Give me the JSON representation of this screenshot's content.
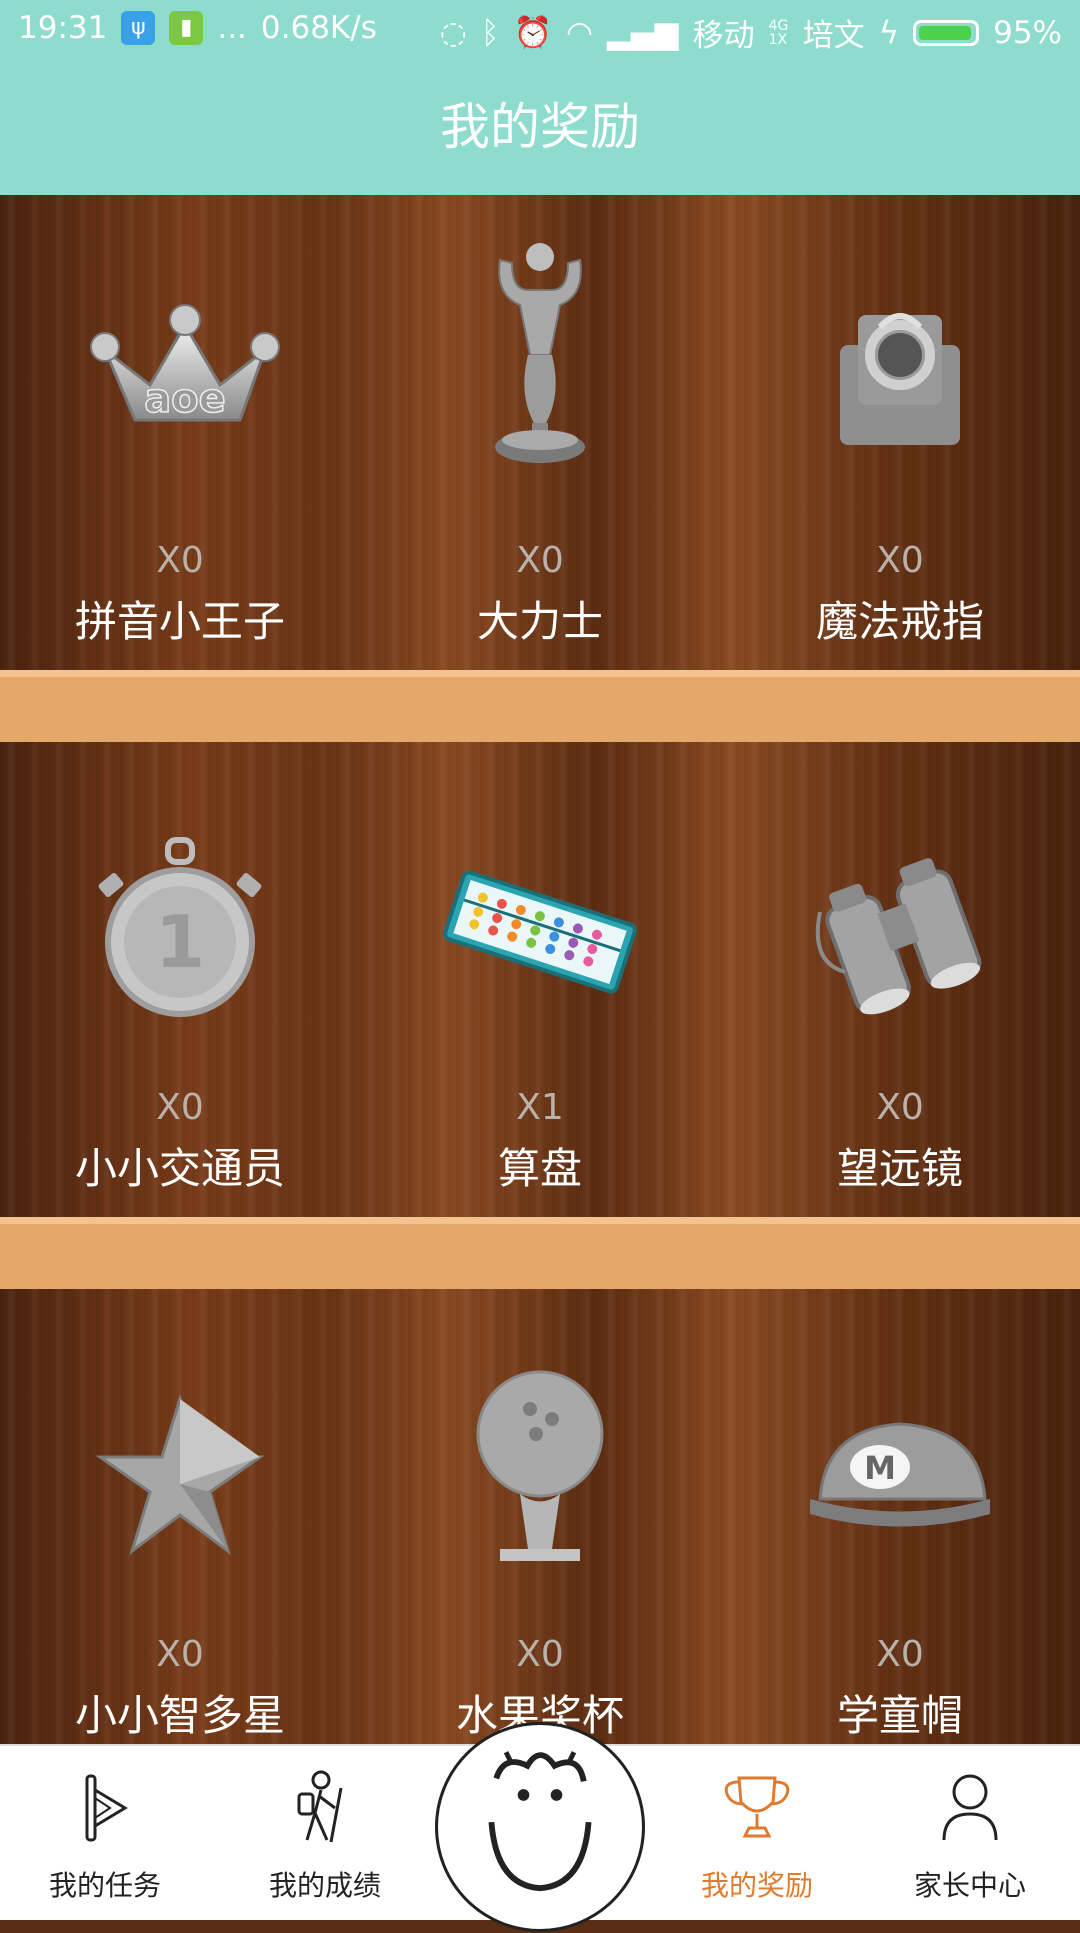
{
  "status_bar": {
    "time": "19:31",
    "more": "...",
    "speed": "0.68K/s",
    "carrier1": "移动",
    "network_type": "4G 1X",
    "carrier2": "培文",
    "battery_percent": "95%",
    "battery_level": 0.95
  },
  "header": {
    "title": "我的奖励"
  },
  "awards": [
    {
      "count": "X0",
      "name": "拼音小王子",
      "icon": "crown-icon",
      "badge_text": "aoe"
    },
    {
      "count": "X0",
      "name": "大力士",
      "icon": "strongman-trophy-icon"
    },
    {
      "count": "X0",
      "name": "魔法戒指",
      "icon": "ring-box-icon"
    },
    {
      "count": "X0",
      "name": "小小交通员",
      "icon": "stopwatch-icon",
      "badge_text": "1"
    },
    {
      "count": "X1",
      "name": "算盘",
      "icon": "abacus-icon"
    },
    {
      "count": "X0",
      "name": "望远镜",
      "icon": "binoculars-icon"
    },
    {
      "count": "X0",
      "name": "小小智多星",
      "icon": "star-icon"
    },
    {
      "count": "X0",
      "name": "水果奖杯",
      "icon": "bowling-trophy-icon"
    },
    {
      "count": "X0",
      "name": "学童帽",
      "icon": "cap-icon",
      "badge_text": "M"
    }
  ],
  "nav": {
    "items": [
      {
        "label": "我的任务",
        "icon": "flag-task-icon"
      },
      {
        "label": "我的成绩",
        "icon": "hiker-icon"
      },
      {
        "label": "我的奖励",
        "icon": "trophy-icon",
        "active": true
      },
      {
        "label": "家长中心",
        "icon": "person-icon"
      }
    ],
    "center_icon": "smiley-face-icon",
    "active_color": "#e07a2e"
  }
}
